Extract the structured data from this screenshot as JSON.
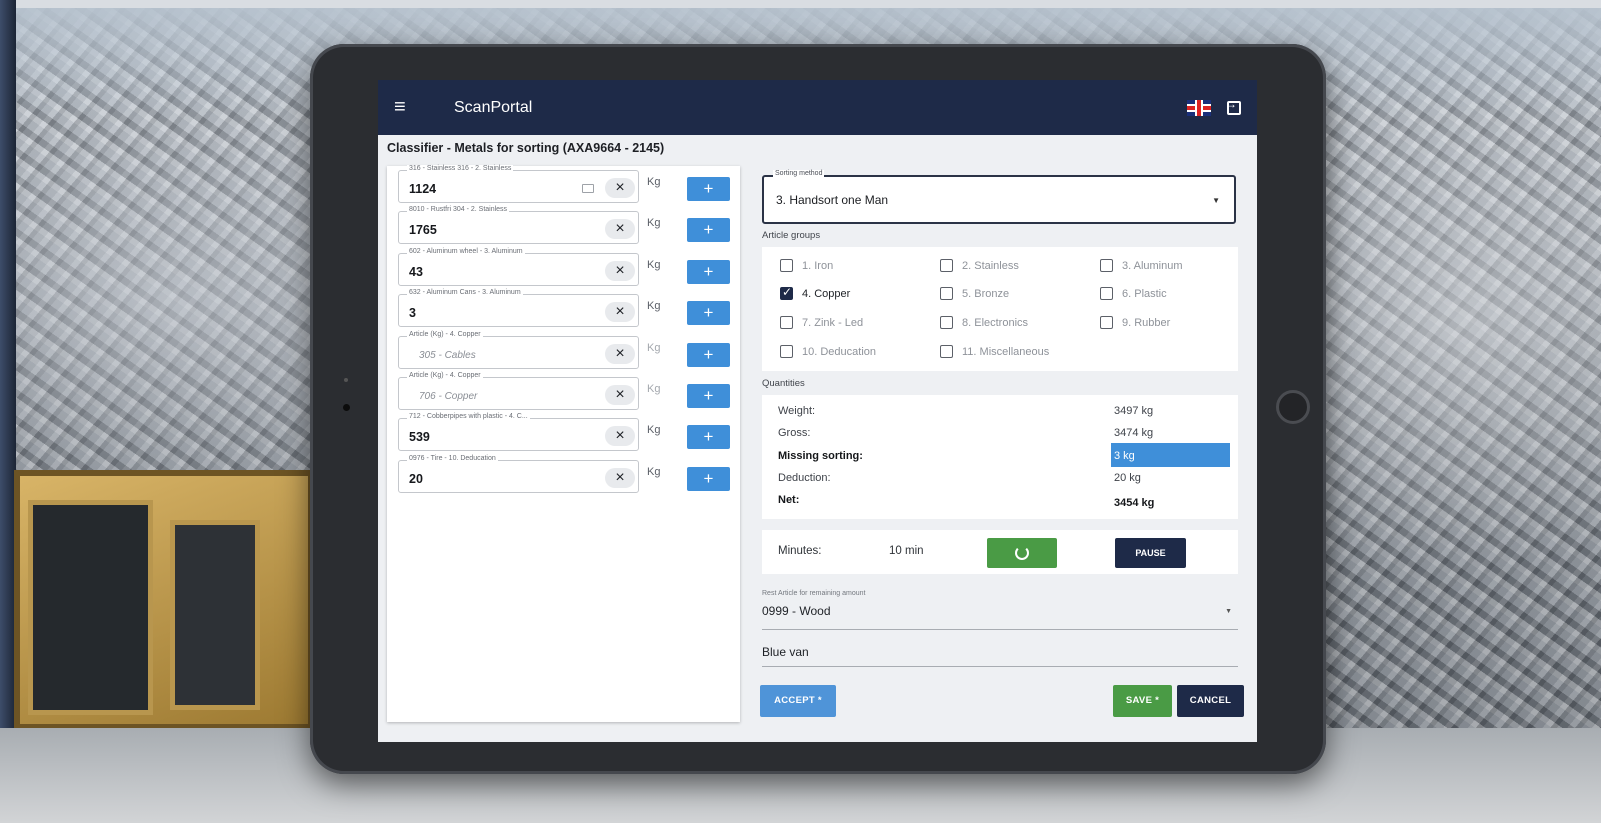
{
  "app": {
    "name": "ScanPortal",
    "accent_color": "#1e2a48",
    "button_blue": "#3f8fd9",
    "button_green": "#4a9b45"
  },
  "page": {
    "title": "Classifier - Metals for sorting (AXA9664 - 2145)"
  },
  "articles": [
    {
      "label": "316 - Stainless 316 - 2. Stainless",
      "value": "1124",
      "placeholder": "",
      "unit": "Kg",
      "has_keyboard_icon": true
    },
    {
      "label": "8010 - Rustfri 304 - 2. Stainless",
      "value": "1765",
      "placeholder": "",
      "unit": "Kg"
    },
    {
      "label": "602 - Aluminum wheel - 3. Aluminum",
      "value": "43",
      "placeholder": "",
      "unit": "Kg"
    },
    {
      "label": "632 - Aluminum Cans - 3. Aluminum",
      "value": "3",
      "placeholder": "",
      "unit": "Kg"
    },
    {
      "label": "Article (Kg) - 4. Copper",
      "value": "",
      "placeholder": "305 - Cables",
      "unit": "Kg"
    },
    {
      "label": "Article (Kg) - 4. Copper",
      "value": "",
      "placeholder": "706 - Copper",
      "unit": "Kg"
    },
    {
      "label": "712 - Cobberpipes with plastic - 4. C...",
      "value": "539",
      "placeholder": "",
      "unit": "Kg"
    },
    {
      "label": "0976 - Tire - 10. Deducation",
      "value": "20",
      "placeholder": "",
      "unit": "Kg"
    }
  ],
  "sorting": {
    "label": "Sorting method",
    "value": "3. Handsort one Man"
  },
  "article_groups": {
    "title": "Article groups",
    "items": [
      {
        "label": "1. Iron",
        "checked": false
      },
      {
        "label": "2. Stainless",
        "checked": false
      },
      {
        "label": "3. Aluminum",
        "checked": false
      },
      {
        "label": "4. Copper",
        "checked": true
      },
      {
        "label": "5. Bronze",
        "checked": false
      },
      {
        "label": "6. Plastic",
        "checked": false
      },
      {
        "label": "7. Zink - Led",
        "checked": false
      },
      {
        "label": "8. Electronics",
        "checked": false
      },
      {
        "label": "9. Rubber",
        "checked": false
      },
      {
        "label": "10. Deducation",
        "checked": false
      },
      {
        "label": "11. Miscellaneous",
        "checked": false
      }
    ]
  },
  "quantities": {
    "title": "Quantities",
    "rows": [
      {
        "label": "Weight:",
        "value": "3497 kg",
        "bold": false
      },
      {
        "label": "Gross:",
        "value": "3474 kg",
        "bold": false
      },
      {
        "label": "Missing sorting:",
        "value": "3 kg",
        "bold": true,
        "highlight": true
      },
      {
        "label": "Deduction:",
        "value": "20 kg",
        "bold": false
      },
      {
        "label": "Net:",
        "value": "3454 kg",
        "bold": true
      }
    ]
  },
  "timer": {
    "label": "Minutes:",
    "value": "10 min",
    "pause_label": "PAUSE"
  },
  "rest_article": {
    "label": "Rest Article for remaining amount",
    "value": "0999 - Wood"
  },
  "note": {
    "value": "Blue van"
  },
  "actions": {
    "accept": "ACCEPT *",
    "save": "SAVE *",
    "cancel": "CANCEL"
  }
}
